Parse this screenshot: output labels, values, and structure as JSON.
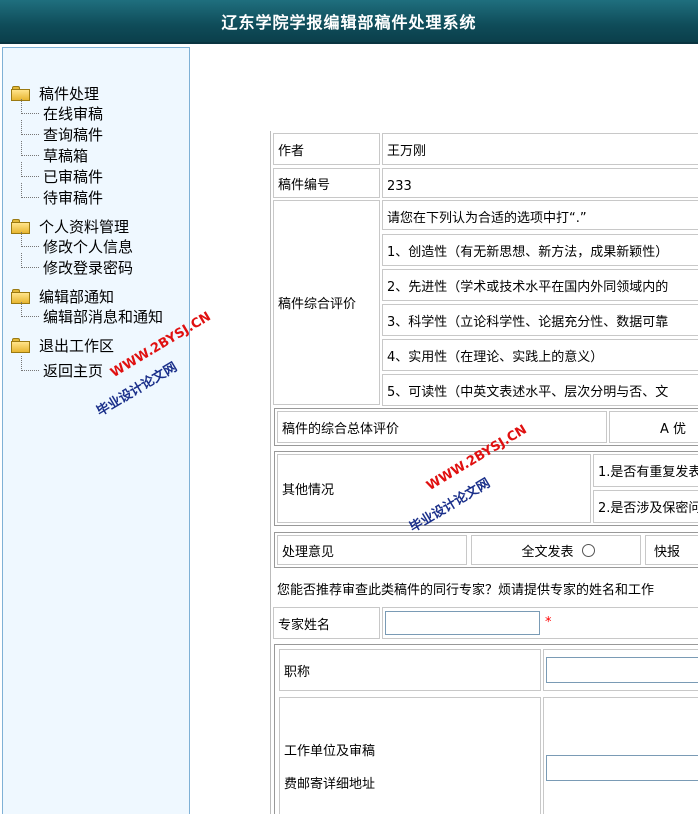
{
  "header": {
    "title": "辽东学院学报编辑部稿件处理系统"
  },
  "sidebar": {
    "groups": [
      {
        "label": "稿件处理",
        "items": [
          "在线审稿",
          "查询稿件",
          "草稿箱",
          "已审稿件",
          "待审稿件"
        ]
      },
      {
        "label": "个人资料管理",
        "items": [
          "修改个人信息",
          "修改登录密码"
        ]
      },
      {
        "label": "编辑部通知",
        "items": [
          "编辑部消息和通知"
        ]
      },
      {
        "label": "退出工作区",
        "items": [
          "返回主页"
        ]
      }
    ]
  },
  "form": {
    "author_label": "作者",
    "author_value": "王万刚",
    "id_label": "稿件编号",
    "id_value": "233",
    "eval_label": "稿件综合评价",
    "eval_intro": "请您在下列认为合适的选项中打“.”",
    "eval_items": [
      "1、创造性（有无新思想、新方法，成果新颖性）",
      "2、先进性（学术或技术水平在国内外同领域内的",
      "3、科学性（立论科学性、论据充分性、数据可靠",
      "4、实用性（在理论、实践上的意义）",
      "5、可读性（中英文表述水平、层次分明与否、文"
    ],
    "overall_label": "稿件的综合总体评价",
    "overall_option": "A 优",
    "other_label": "其他情况",
    "other_items": [
      "1.是否有重复发表",
      "2.是否涉及保密问"
    ],
    "handle_label": "处理意见",
    "handle_option1": "全文发表",
    "handle_option2": "快报",
    "recommend_text": "您能否推荐审查此类稿件的同行专家？烦请提供专家的姓名和工作",
    "expert_name_label": "专家姓名",
    "required_mark": "*",
    "title_label": "职称",
    "address_label_1": "工作单位及审稿",
    "address_label_2": "费邮寄详细地址"
  },
  "watermarks": {
    "url": "WWW.2BYSJ.CN",
    "cn": "毕业设计论文网"
  },
  "colors": {
    "header_bg": "#0f4c59",
    "sidebar_bg": "#eff8ff",
    "sidebar_border": "#7fb1d6",
    "required": "#ff0000"
  }
}
